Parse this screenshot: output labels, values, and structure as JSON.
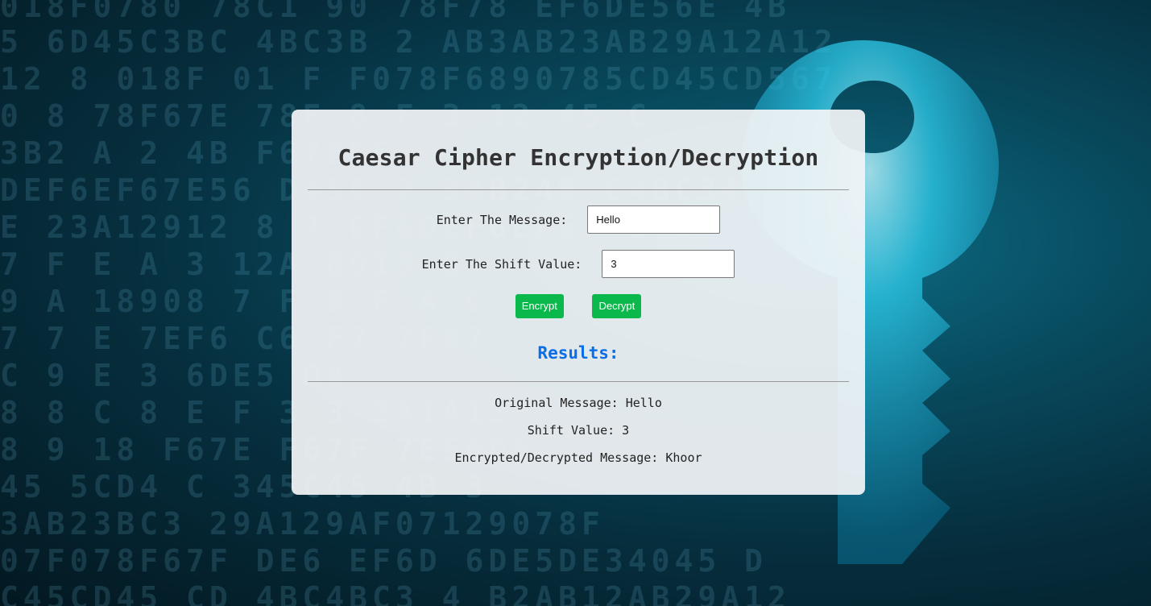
{
  "background": {
    "rows": [
      "018F0780   78C1  90  78F78  EF6DE56E 4B",
      "5  6D45C3BC  4BC3B   2 AB3AB23AB29A12A12",
      "12  8 018F  01  F  F078F6890785CD45CD567",
      "0 8 78F67E      78F  8 F  3  12  45 C",
      "3B2      A           2       4B  F678F6",
      "DEF6EF67E56   D45C   7    34B24B  C4BC34",
      "E   23A12912  8   7  EF6DEF6EF67  8 7",
      "     7 F       E  A   3  12A  8918  0",
      "9  A   18908  7  F  8  F     A  C",
      " 7  7  E  7EF6     C6     F7  7F07",
      "         C    9  E   3  6DE5      D4",
      "  8       8   C  8  E  F  3 3 2A1A12",
      "   8  9    18  F67E  F67F    7E56D5",
      "    45  5CD4  C 345C45  4B       3",
      "   3AB23BC3      29A129AF07129078F",
      "  07F078F67F  DE6 EF6D  6DE5DE34045 D",
      "  C45CD45  CD  4BC4BC3  4  B2AB12AB29A12"
    ]
  },
  "card": {
    "title": "Caesar Cipher Encryption/Decryption",
    "message_label": "Enter The Message:",
    "message_value": "Hello",
    "shift_label": "Enter The Shift Value:",
    "shift_value": "3",
    "encrypt_label": "Encrypt",
    "decrypt_label": "Decrypt",
    "results_title": "Results:",
    "original_line": "Original Message: Hello",
    "shift_line": "Shift Value: 3",
    "output_line": "Encrypted/Decrypted Message: Khoor"
  },
  "colors": {
    "button": "#0bb84b",
    "results_title": "#0a6ee8",
    "card_background": "#f2f4f6"
  },
  "icons": [
    "key-icon"
  ]
}
